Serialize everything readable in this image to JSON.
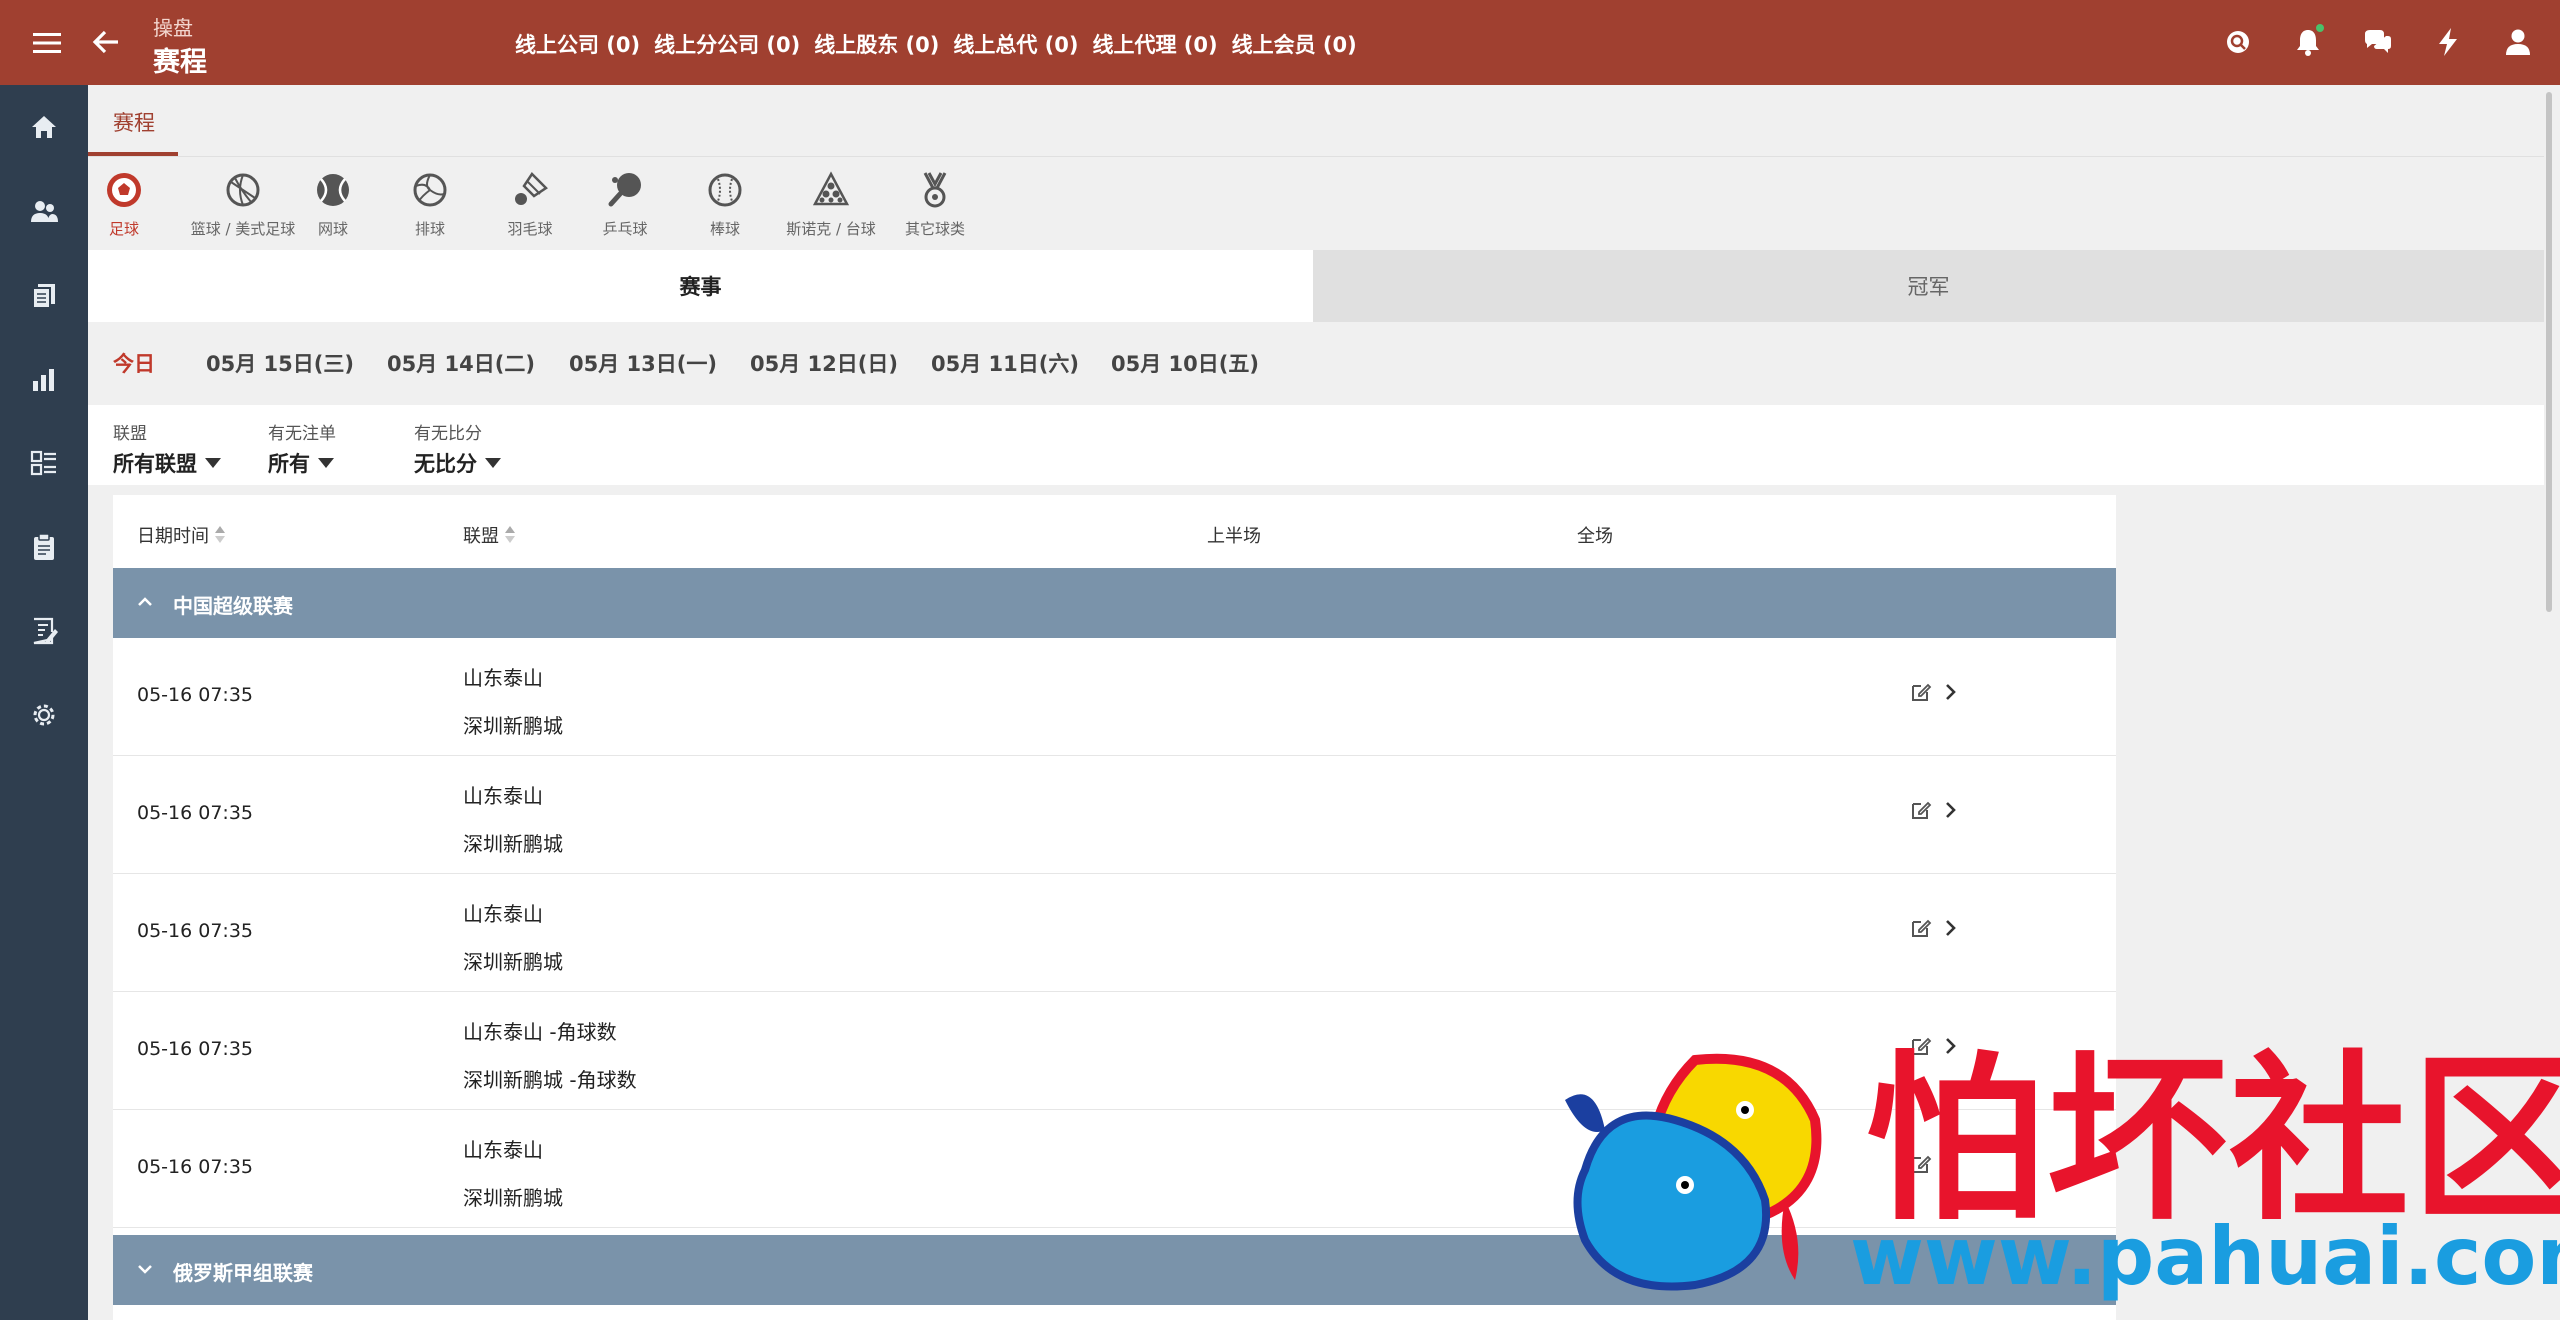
{
  "header": {
    "crumb": "操盘",
    "title": "赛程",
    "counts": [
      "线上公司 (0)",
      "线上分公司 (0)",
      "线上股东 (0)",
      "线上总代 (0)",
      "线上代理 (0)",
      "线上会员 (0)"
    ],
    "tools": [
      "search-icon",
      "bell-icon",
      "chat-icon",
      "bolt-icon",
      "user-icon"
    ]
  },
  "sidebar": {
    "items": [
      "home-icon",
      "users-icon",
      "docs-icon",
      "chart-icon",
      "list-icon",
      "clipboard-icon",
      "report-icon",
      "settings-icon"
    ]
  },
  "tabs": {
    "active": "赛程"
  },
  "sports": [
    {
      "label": "足球",
      "icon": "soccer-icon",
      "active": true
    },
    {
      "label": "篮球 / 美式足球",
      "icon": "basketball-icon",
      "active": false
    },
    {
      "label": "网球",
      "icon": "tennis-icon",
      "active": false
    },
    {
      "label": "排球",
      "icon": "volleyball-icon",
      "active": false
    },
    {
      "label": "羽毛球",
      "icon": "badminton-icon",
      "active": false
    },
    {
      "label": "乒乓球",
      "icon": "pingpong-icon",
      "active": false
    },
    {
      "label": "棒球",
      "icon": "baseball-icon",
      "active": false
    },
    {
      "label": "斯诺克 / 台球",
      "icon": "snooker-icon",
      "active": false
    },
    {
      "label": "其它球类",
      "icon": "medal-icon",
      "active": false
    }
  ],
  "segment": {
    "matches": "赛事",
    "champion": "冠军"
  },
  "dates": [
    "今日",
    "05月 15日(三)",
    "05月 14日(二)",
    "05月 13日(一)",
    "05月 12日(日)",
    "05月 11日(六)",
    "05月 10日(五)"
  ],
  "filters": {
    "league": {
      "label": "联盟",
      "value": "所有联盟"
    },
    "bets": {
      "label": "有无注单",
      "value": "所有"
    },
    "score": {
      "label": "有无比分",
      "value": "无比分"
    }
  },
  "table": {
    "headers": {
      "datetime": "日期时间",
      "league": "联盟",
      "first_half": "上半场",
      "full": "全场"
    },
    "groups": [
      {
        "name": "中国超级联赛",
        "expanded": true,
        "rows": [
          {
            "time": "05-16 07:35",
            "home": "山东泰山",
            "away": "深圳新鹏城"
          },
          {
            "time": "05-16 07:35",
            "home": "山东泰山",
            "away": "深圳新鹏城"
          },
          {
            "time": "05-16 07:35",
            "home": "山东泰山",
            "away": "深圳新鹏城"
          },
          {
            "time": "05-16 07:35",
            "home": "山东泰山 -角球数",
            "away": "深圳新鹏城 -角球数"
          },
          {
            "time": "05-16 07:35",
            "home": "山东泰山",
            "away": "深圳新鹏城"
          }
        ]
      },
      {
        "name": "俄罗斯甲组联赛",
        "expanded": false,
        "rows": []
      }
    ]
  },
  "watermark": {
    "cn": "怕坏社区",
    "url": "www.pahuai.com"
  },
  "colors": {
    "header": "#a04030",
    "sidebar": "#2f3e4f",
    "group": "#7a93aa",
    "accent": "#c0392b"
  }
}
